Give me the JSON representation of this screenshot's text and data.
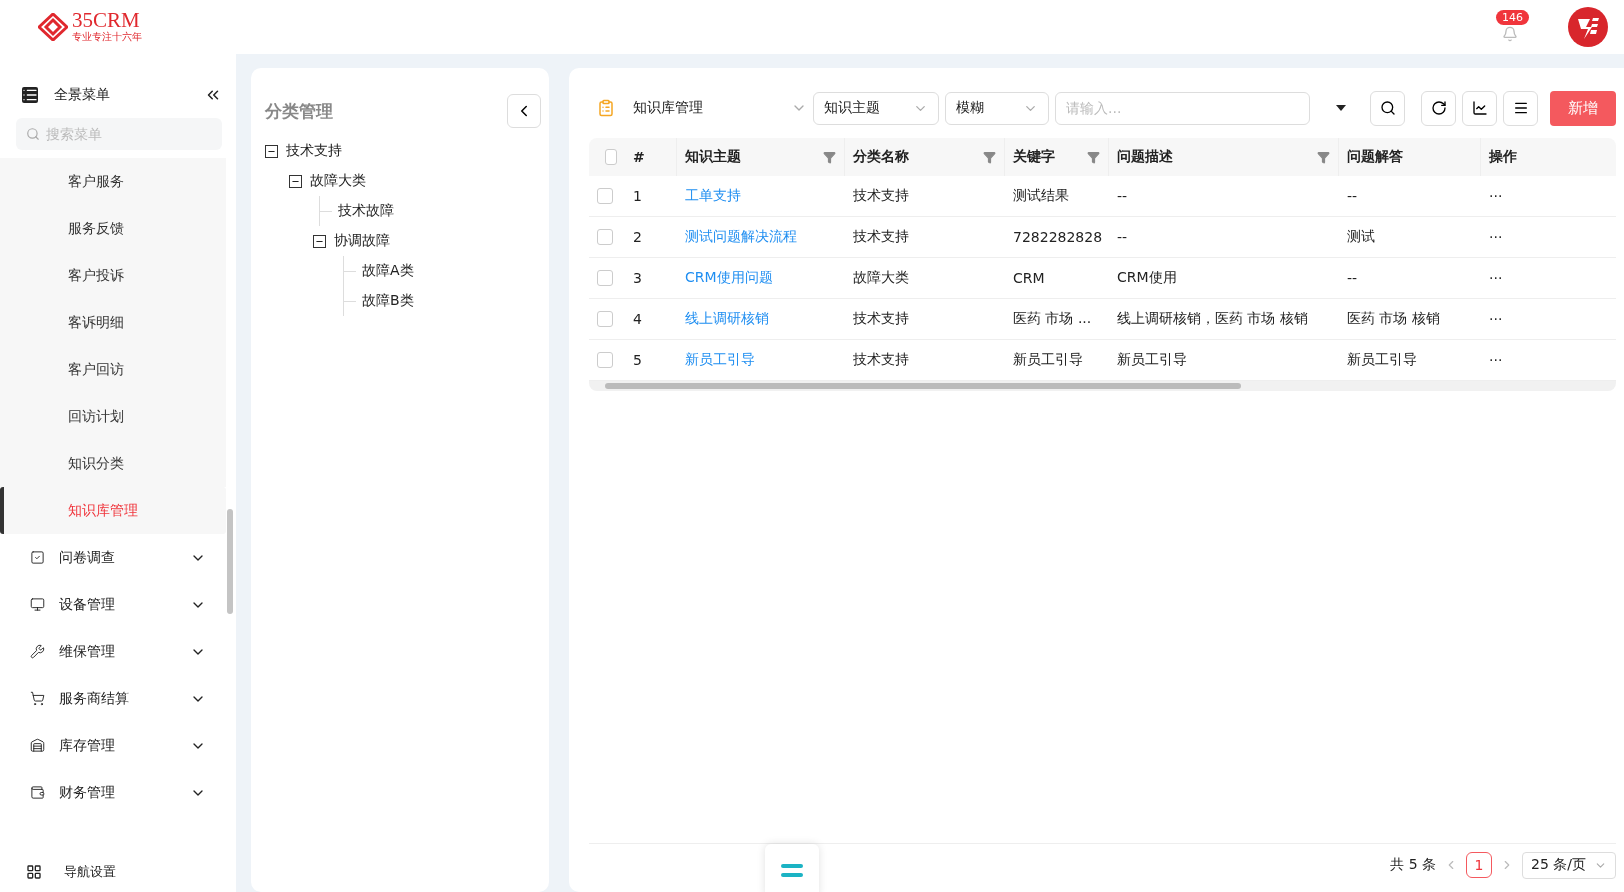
{
  "header": {
    "logo": {
      "name": "35CRM",
      "tagline": "专业专注十六年"
    },
    "notifications": "146"
  },
  "sidebar": {
    "title": "全景菜单",
    "search": {
      "placeholder": "搜索菜单"
    },
    "items": [
      {
        "kind": "sub",
        "label": "客户服务",
        "selected": false
      },
      {
        "kind": "sub",
        "label": "服务反馈",
        "selected": false
      },
      {
        "kind": "sub",
        "label": "客户投诉",
        "selected": false
      },
      {
        "kind": "sub",
        "label": "客诉明细",
        "selected": false
      },
      {
        "kind": "sub",
        "label": "客户回访",
        "selected": false
      },
      {
        "kind": "sub",
        "label": "回访计划",
        "selected": false
      },
      {
        "kind": "sub",
        "label": "知识分类",
        "selected": false
      },
      {
        "kind": "sub",
        "label": "知识库管理",
        "selected": true
      },
      {
        "kind": "group",
        "label": "问卷调查",
        "expanded": false
      },
      {
        "kind": "group",
        "label": "设备管理",
        "expanded": false
      },
      {
        "kind": "group",
        "label": "维保管理",
        "expanded": false
      },
      {
        "kind": "group",
        "label": "服务商结算",
        "expanded": false
      },
      {
        "kind": "group",
        "label": "库存管理",
        "expanded": false
      },
      {
        "kind": "group",
        "label": "财务管理",
        "expanded": false
      }
    ],
    "footer": "导航设置"
  },
  "category_panel": {
    "title": "分类管理",
    "tree": [
      {
        "label": "技术支持",
        "expanded": true,
        "children": [
          {
            "label": "故障大类",
            "expanded": true,
            "children": [
              {
                "label": "技术故障"
              },
              {
                "label": "协调故障",
                "expanded": true,
                "children": [
                  {
                    "label": "故障A类"
                  },
                  {
                    "label": "故障B类"
                  }
                ]
              }
            ]
          }
        ]
      }
    ]
  },
  "toolbar": {
    "view": "知识库管理",
    "field": "知识主题",
    "match": "模糊",
    "search": {
      "placeholder": "请输入..."
    },
    "add_button": "新增"
  },
  "table": {
    "columns": [
      {
        "label": "#",
        "filter": false
      },
      {
        "label": "知识主题",
        "filter": true
      },
      {
        "label": "分类名称",
        "filter": true
      },
      {
        "label": "关键字",
        "filter": true
      },
      {
        "label": "问题描述",
        "filter": true
      },
      {
        "label": "问题解答",
        "filter": false
      },
      {
        "label": "操作",
        "filter": false
      }
    ],
    "all_checked": false,
    "rows": [
      {
        "checked": false,
        "no": "1",
        "topic": "工单支持",
        "category": "技术支持",
        "keywords": "测试结果",
        "description": "--",
        "answer": "--",
        "actions": "···"
      },
      {
        "checked": false,
        "no": "2",
        "topic": "测试问题解决流程",
        "category": "技术支持",
        "keywords": "7282282828",
        "description": "--",
        "answer": "测试",
        "actions": "···"
      },
      {
        "checked": false,
        "no": "3",
        "topic": "CRM使用问题",
        "category": "故障大类",
        "keywords": "CRM",
        "description": "CRM使用",
        "answer": "--",
        "actions": "···"
      },
      {
        "checked": false,
        "no": "4",
        "topic": "线上调研核销",
        "category": "技术支持",
        "keywords": "医药 市场 ...",
        "description": "线上调研核销，医药 市场 核销",
        "answer": "医药 市场 核销",
        "actions": "···"
      },
      {
        "checked": false,
        "no": "5",
        "topic": "新员工引导",
        "category": "技术支持",
        "keywords": "新员工引导",
        "description": "新员工引导",
        "answer": "新员工引导",
        "actions": "···"
      }
    ]
  },
  "pagination": {
    "total": "共 5 条",
    "pages": [
      {
        "label": "1",
        "selected": true
      }
    ],
    "page_size": "25 条/页"
  }
}
